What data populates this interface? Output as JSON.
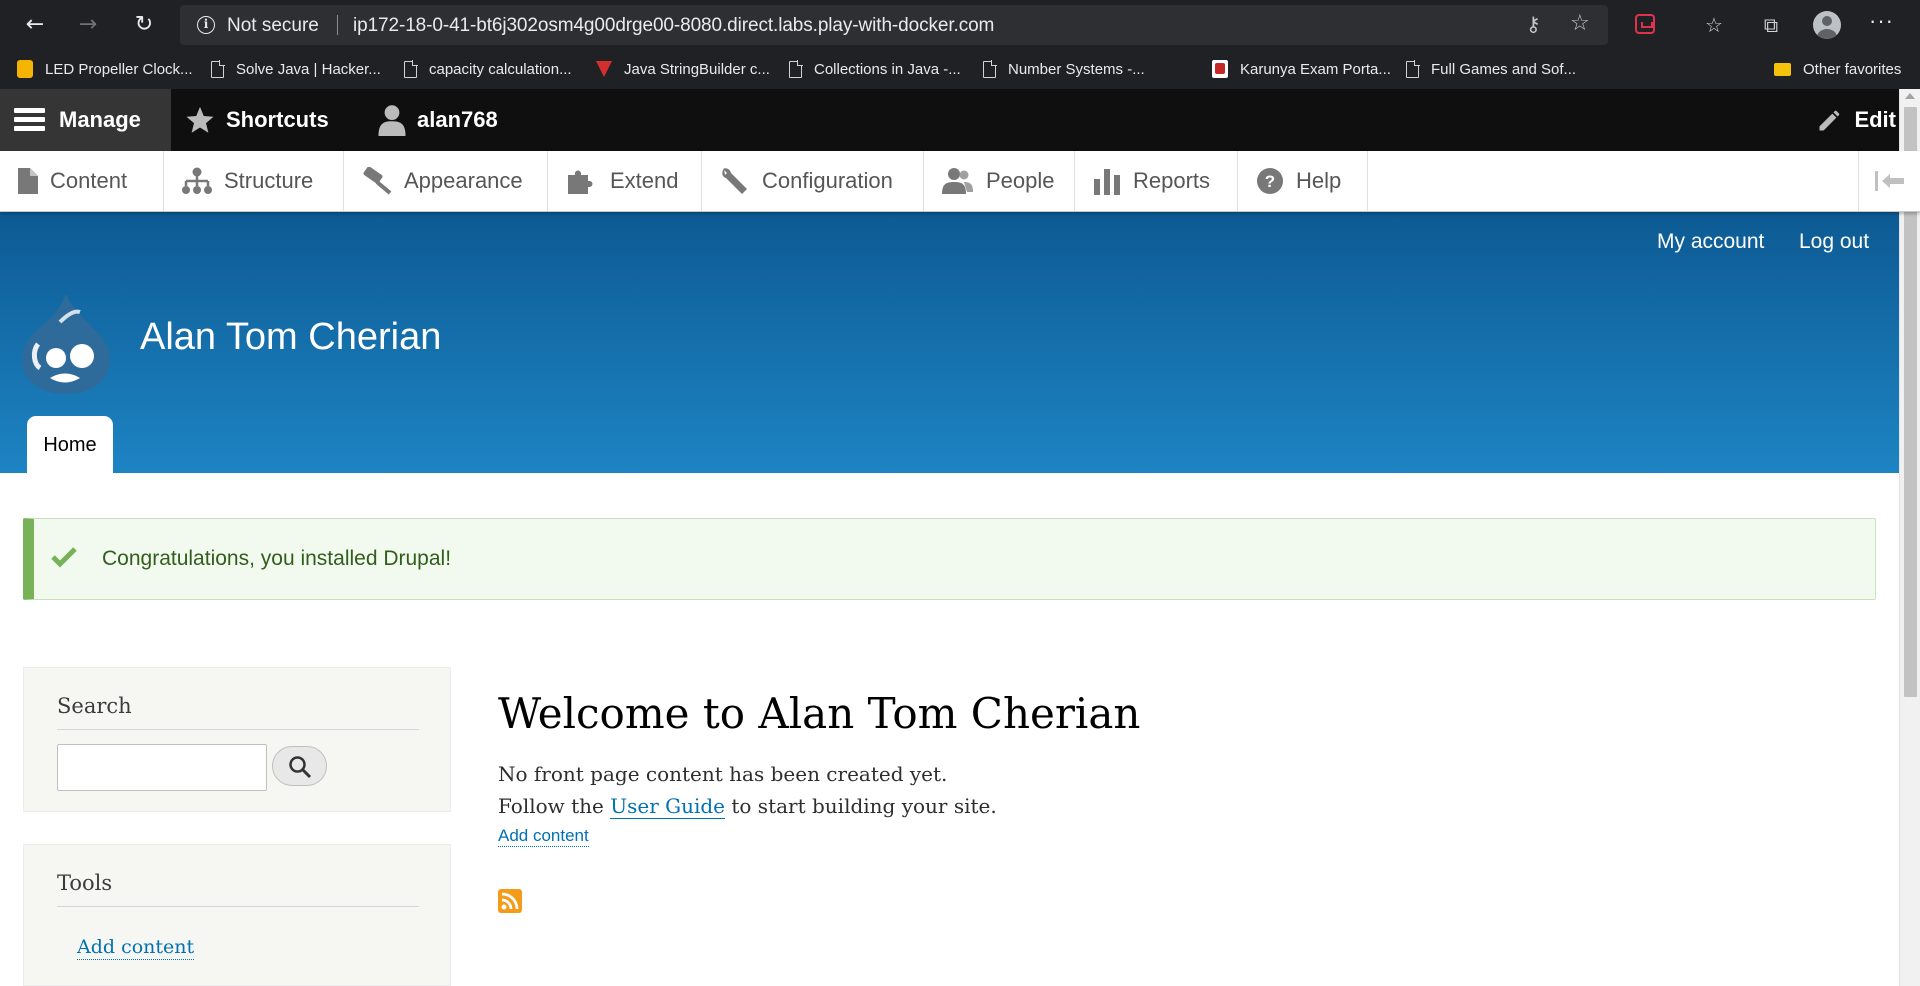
{
  "browser": {
    "security_label": "Not secure",
    "url": "ip172-18-0-41-bt6j302osm4g00drge00-8080.direct.labs.play-with-docker.com",
    "bookmarks": [
      {
        "label": "LED Propeller Clock...",
        "icon": "yellow-bookmark-icon"
      },
      {
        "label": "Solve Java | Hacker...",
        "icon": "page-icon"
      },
      {
        "label": "capacity calculation...",
        "icon": "page-icon"
      },
      {
        "label": "Java StringBuilder c...",
        "icon": "red-triangle-icon"
      },
      {
        "label": "Collections in Java -...",
        "icon": "page-icon"
      },
      {
        "label": "Number Systems -...",
        "icon": "page-icon"
      },
      {
        "label": "Karunya Exam Porta...",
        "icon": "karunya-icon"
      },
      {
        "label": "Full Games and Sof...",
        "icon": "page-icon"
      }
    ],
    "other_favorites": "Other favorites"
  },
  "admin_toolbar": {
    "manage": "Manage",
    "shortcuts": "Shortcuts",
    "user": "alan768",
    "edit": "Edit"
  },
  "admin_menu": [
    {
      "label": "Content",
      "icon": "file-icon"
    },
    {
      "label": "Structure",
      "icon": "sitemap-icon"
    },
    {
      "label": "Appearance",
      "icon": "paint-roller-icon"
    },
    {
      "label": "Extend",
      "icon": "puzzle-icon"
    },
    {
      "label": "Configuration",
      "icon": "wrench-icon"
    },
    {
      "label": "People",
      "icon": "people-icon"
    },
    {
      "label": "Reports",
      "icon": "bar-chart-icon"
    },
    {
      "label": "Help",
      "icon": "help-icon"
    }
  ],
  "header": {
    "my_account": "My account",
    "log_out": "Log out",
    "site_name": "Alan Tom Cherian",
    "tab_home": "Home"
  },
  "status_message": "Congratulations, you installed Drupal!",
  "sidebar": {
    "search_title": "Search",
    "search_value": "",
    "tools_title": "Tools",
    "tools_link": "Add content"
  },
  "main": {
    "title": "Welcome to Alan Tom Cherian",
    "line1": "No front page content has been created yet.",
    "line2_prefix": "Follow the",
    "line2_link": "User Guide",
    "line2_suffix": "to start building your site.",
    "add_content": "Add content"
  },
  "colors": {
    "header_top": "#0d5a93",
    "header_bottom": "#1d84c3",
    "status_green": "#77b259",
    "link_blue": "#0071b3"
  }
}
